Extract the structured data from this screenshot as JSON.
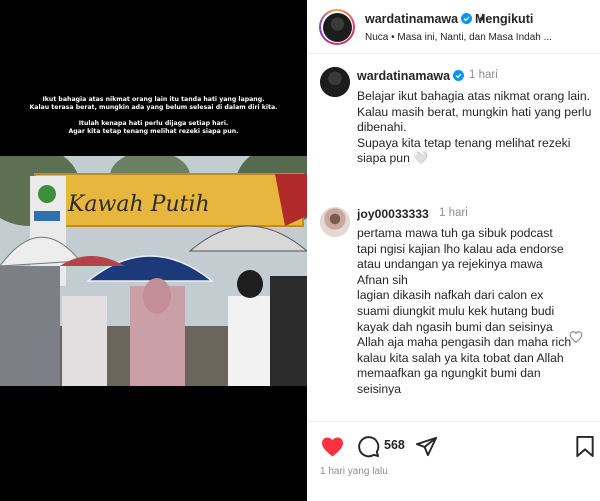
{
  "media": {
    "overlay_lines_1": [
      "Ikut bahagia atas nikmat orang lain itu tanda hati yang lapang.",
      "Kalau terasa berat, mungkin ada yang belum selesai di dalam diri kita."
    ],
    "overlay_lines_2": [
      "Itulah kenapa hati perlu dijaga setiap hari.",
      "Agar kita tetap tenang melihat rezeki siapa pun."
    ],
    "sign_text": "Kawah Putih"
  },
  "header": {
    "username": "wardatinamawa",
    "separator": "•",
    "follow_label": "Mengikuti",
    "subtitle": "Nuca • Masa ini, Nanti, dan Masa Indah ..."
  },
  "caption": {
    "username": "wardatinamawa",
    "time": "1 hari",
    "lines": [
      "Belajar ikut bahagia atas nikmat orang lain.",
      "Kalau masih berat, mungkin hati yang perlu dibenahi.",
      "Supaya kita tetap tenang melihat rezeki siapa pun 🤍"
    ]
  },
  "comment": {
    "username": "joy00033333",
    "time": "1 hari",
    "paragraphs": [
      "pertama mawa tuh ga sibuk podcast tapi ngisi kajian lho kalau ada endorse atau undangan ya rejekinya mawa Afnan sih",
      "lagian dikasih nafkah dari calon ex suami diungkit mulu kek hutang budi kayak dah ngasih bumi dan seisinya",
      "Allah aja maha pengasih dan maha rich kalau kita salah ya kita tobat dan Allah memaafkan ga ngungkit bumi dan seisinya"
    ]
  },
  "actions": {
    "comment_count": "568",
    "time_ago": "1 hari yang lalu"
  },
  "colors": {
    "liked": "#ff3040",
    "verified": "#0095f6",
    "muted": "#8e8e8e"
  }
}
